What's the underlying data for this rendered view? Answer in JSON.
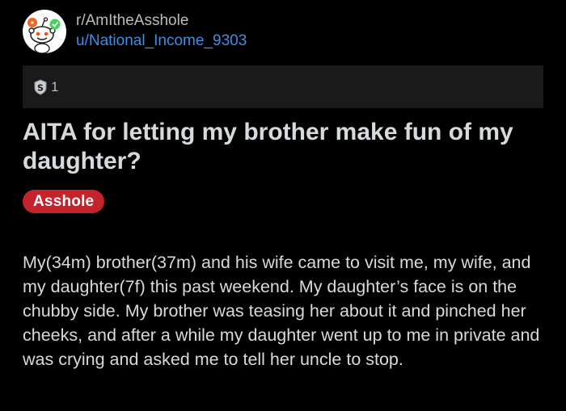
{
  "post": {
    "subreddit": "r/AmItheAsshole",
    "username": "u/National_Income_9303",
    "award_icon": "silver-award-icon",
    "award_count": "1",
    "title": "AITA for letting my brother make fun of my daughter?",
    "flair": "Asshole",
    "body": "My(34m) brother(37m) and his wife came to visit me, my wife, and my daughter(7f) this past weekend. My daughter’s face is on the chubby side. My brother was teasing her about it and pinched her cheeks, and after a while my daughter went up to me in private and was crying and asked me to tell her uncle to stop."
  },
  "colors": {
    "background": "#000000",
    "text": "#d7dadc",
    "username": "#3f8de6",
    "flair_bg": "#c4232b",
    "award_bar_bg": "#1a1a1b"
  }
}
